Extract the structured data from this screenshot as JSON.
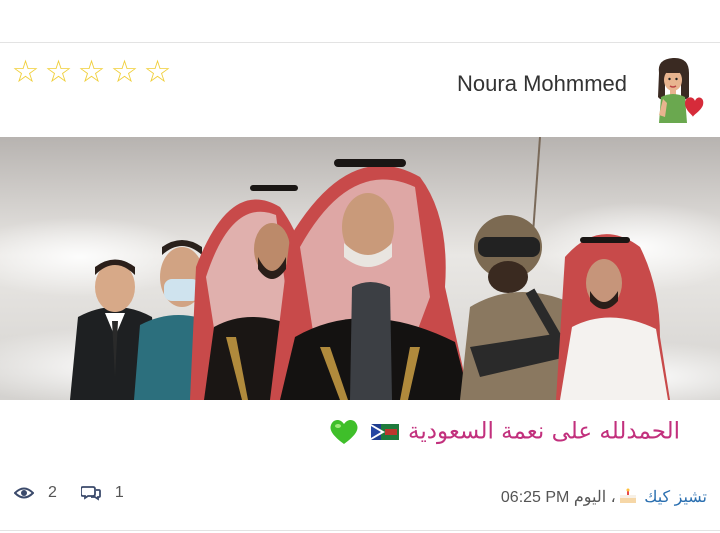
{
  "post": {
    "author_name": "Noura Mohmmed",
    "rating_stars": [
      "☆",
      "☆",
      "☆",
      "☆",
      "☆"
    ],
    "rating_value": 0,
    "caption_text": "الحمدلله على نعمة السعودية",
    "caption_emojis": [
      "saudi-flag-icon",
      "green-heart-icon"
    ],
    "views_count": "2",
    "comments_count": "1",
    "meta_user": "تشيز كيك",
    "meta_separator": "،",
    "meta_day": "اليوم",
    "meta_time": "06:25 PM"
  },
  "colors": {
    "star": "#f0cf3a",
    "caption": "#c2307d",
    "link": "#2a6fb0",
    "meta": "#555555"
  },
  "icons": {
    "avatar": "bitmoji-avatar-with-heart",
    "views": "eye-icon",
    "comments": "comments-icon",
    "cake": "cake-icon"
  }
}
